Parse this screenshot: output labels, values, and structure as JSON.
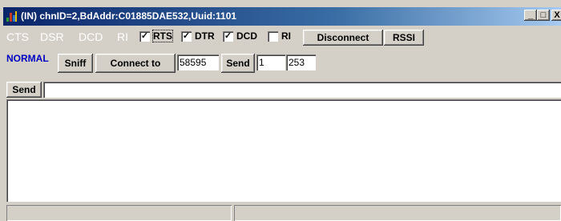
{
  "window": {
    "title": "(IN) chnID=2,BdAddr:C01885DAE532,Uuid:1101",
    "min_label": "_",
    "max_label": "□",
    "close_label": "X"
  },
  "signals": {
    "lamps": [
      "CTS",
      "DSR",
      "DCD",
      "RI"
    ],
    "checkboxes": [
      {
        "label": "RTS",
        "checked": true,
        "mark": "✓"
      },
      {
        "label": "DTR",
        "checked": true,
        "mark": "✓"
      },
      {
        "label": "DCD",
        "checked": true,
        "mark": "✓"
      },
      {
        "label": "RI",
        "checked": false,
        "mark": ""
      }
    ],
    "disconnect_label": "Disconnect",
    "rssi_label": "RSSI"
  },
  "connect_row": {
    "mode": "NORMAL",
    "sniff_label": "Sniff",
    "connect_label": "Connect to",
    "port_value": "58595",
    "send_label": "Send",
    "count_value": "1",
    "size_value": "253"
  },
  "send_row": {
    "send_label": "Send",
    "text_value": ""
  },
  "colors": {
    "title_bar": "#0a246a",
    "mode_text": "#0000c0",
    "lamp_text": "#ffffff"
  }
}
